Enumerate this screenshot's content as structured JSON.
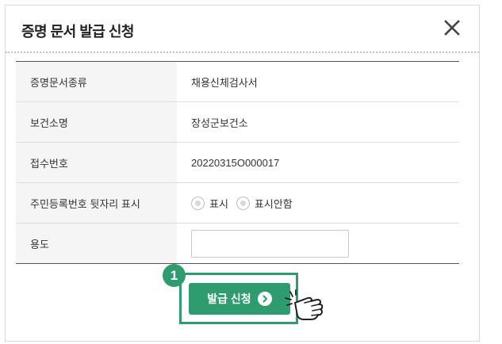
{
  "dialog": {
    "title": "증명 문서 발급 신청"
  },
  "form": {
    "rows": [
      {
        "label": "증명문서종류",
        "value": "채용신체검사서"
      },
      {
        "label": "보건소명",
        "value": "장성군보건소"
      },
      {
        "label": "접수번호",
        "value": "20220315O000017"
      },
      {
        "label": "주민등록번호 뒷자리 표시"
      },
      {
        "label": "용도"
      }
    ],
    "radio_options": [
      "표시",
      "표시안함"
    ],
    "purpose_input_value": ""
  },
  "step_badge": "1",
  "submit_button": {
    "label": "발급 신청"
  },
  "icons": {
    "close": "close-icon",
    "arrow": "chevron-right-circle-icon",
    "hand": "pointing-hand-icon"
  },
  "colors": {
    "accent": "#2e9c6e",
    "header_rule": "#555555",
    "label_bg": "#f5f5f5"
  }
}
